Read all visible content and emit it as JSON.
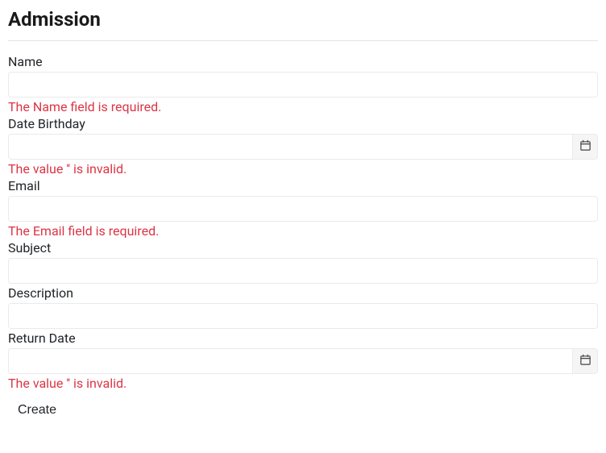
{
  "title": "Admission",
  "fields": {
    "name": {
      "label": "Name",
      "value": "",
      "error": "The Name field is required."
    },
    "date_birthday": {
      "label": "Date Birthday",
      "value": "",
      "error": "The value '' is invalid."
    },
    "email": {
      "label": "Email",
      "value": "",
      "error": "The Email field is required."
    },
    "subject": {
      "label": "Subject",
      "value": ""
    },
    "description": {
      "label": "Description",
      "value": ""
    },
    "return_date": {
      "label": "Return Date",
      "value": "",
      "error": "The value '' is invalid."
    }
  },
  "buttons": {
    "create": "Create"
  }
}
